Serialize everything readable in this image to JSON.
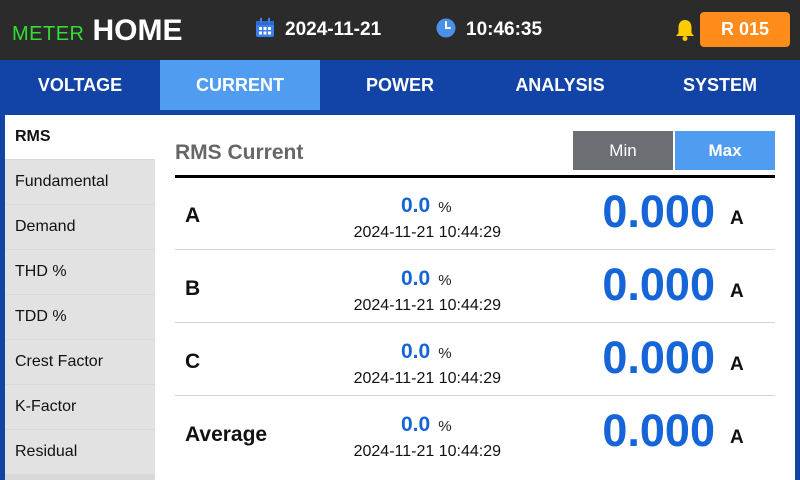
{
  "header": {
    "brand_prefix": "METER",
    "title": "HOME",
    "date": "2024-11-21",
    "time": "10:46:35",
    "badge": "R 015",
    "icons": {
      "date": "calendar-icon",
      "time": "clock-icon",
      "alert": "bell-icon"
    },
    "colors": {
      "brand_prefix": "#33dd33",
      "badge": "#ff8c1a",
      "bell": "#ffcc00"
    }
  },
  "tabs": [
    {
      "label": "VOLTAGE",
      "active": false
    },
    {
      "label": "CURRENT",
      "active": true
    },
    {
      "label": "POWER",
      "active": false
    },
    {
      "label": "ANALYSIS",
      "active": false
    },
    {
      "label": "SYSTEM",
      "active": false
    }
  ],
  "sidebar": {
    "items": [
      {
        "label": "RMS",
        "active": true
      },
      {
        "label": "Fundamental",
        "active": false
      },
      {
        "label": "Demand",
        "active": false
      },
      {
        "label": "THD %",
        "active": false
      },
      {
        "label": "TDD %",
        "active": false
      },
      {
        "label": "Crest Factor",
        "active": false
      },
      {
        "label": "K-Factor",
        "active": false
      },
      {
        "label": "Residual",
        "active": false
      }
    ]
  },
  "main": {
    "title": "RMS Current",
    "buttons": {
      "min": "Min",
      "max": "Max",
      "selected": "Max"
    },
    "rows": [
      {
        "label": "A",
        "percent": "0.0",
        "percent_unit": "%",
        "timestamp": "2024-11-21 10:44:29",
        "value": "0.000",
        "unit": "A"
      },
      {
        "label": "B",
        "percent": "0.0",
        "percent_unit": "%",
        "timestamp": "2024-11-21 10:44:29",
        "value": "0.000",
        "unit": "A"
      },
      {
        "label": "C",
        "percent": "0.0",
        "percent_unit": "%",
        "timestamp": "2024-11-21 10:44:29",
        "value": "0.000",
        "unit": "A"
      },
      {
        "label": "Average",
        "percent": "0.0",
        "percent_unit": "%",
        "timestamp": "2024-11-21 10:44:29",
        "value": "0.000",
        "unit": "A"
      }
    ]
  },
  "colors": {
    "tab_bar": "#1244a8",
    "tab_active": "#4f9cf0",
    "value_blue": "#1565d8"
  }
}
